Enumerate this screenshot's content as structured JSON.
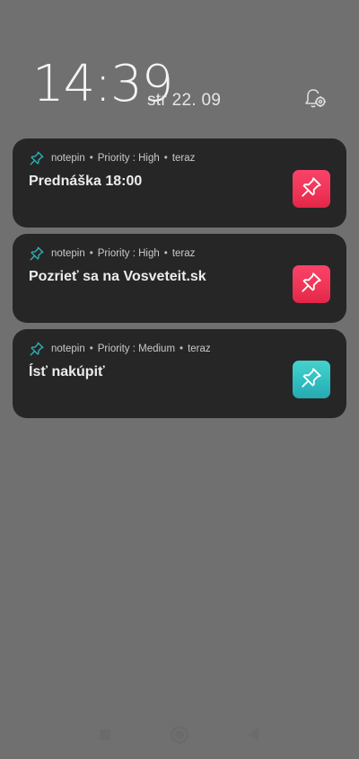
{
  "status": {
    "time": "14:39",
    "date": "str 22. 09"
  },
  "colors": {
    "high": "#ef3456",
    "medium": "#2fbcc0",
    "app_icon": "#2fb3b6"
  },
  "notifications": [
    {
      "app": "notepin",
      "priority": "Priority : High",
      "when": "teraz",
      "title": "Prednáška 18:00",
      "level": "high",
      "icon": "pushpin-icon"
    },
    {
      "app": "notepin",
      "priority": "Priority : High",
      "when": "teraz",
      "title": "Pozrieť sa na Vosveteit.sk",
      "level": "high",
      "icon": "pushpin-icon"
    },
    {
      "app": "notepin",
      "priority": "Priority : Medium",
      "when": "teraz",
      "title": "Ísť nakúpiť",
      "level": "medium",
      "icon": "pushpin-icon"
    }
  ],
  "navbar": {
    "recents_icon": "square-icon",
    "home_icon": "circle-icon",
    "back_icon": "triangle-back-icon"
  }
}
